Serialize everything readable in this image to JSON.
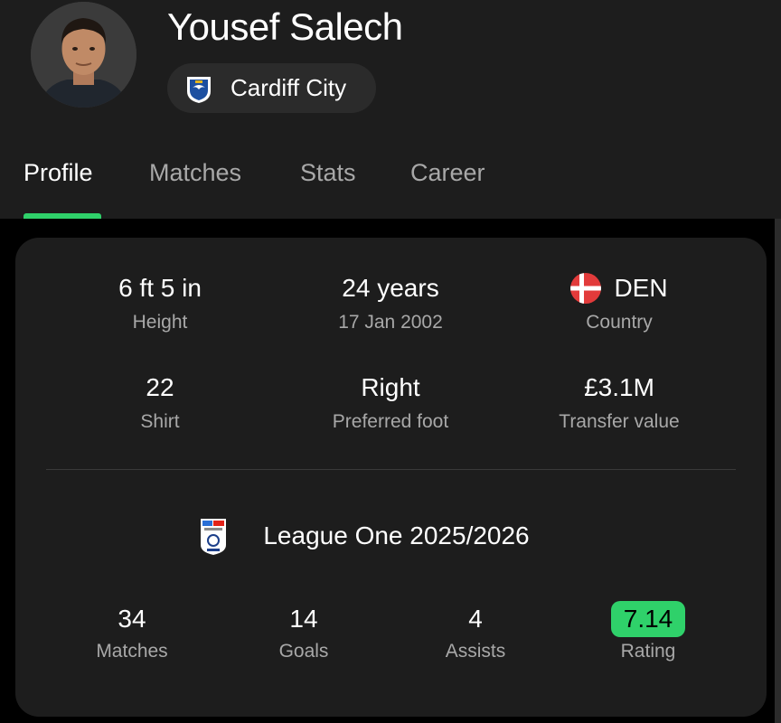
{
  "player": {
    "name": "Yousef Salech",
    "team": "Cardiff City"
  },
  "tabs": [
    "Profile",
    "Matches",
    "Stats",
    "Career"
  ],
  "active_tab": "Profile",
  "info": {
    "height": {
      "value": "6 ft 5 in",
      "label": "Height"
    },
    "age": {
      "value": "24 years",
      "label": "17 Jan 2002"
    },
    "country": {
      "value": "DEN",
      "label": "Country"
    },
    "shirt": {
      "value": "22",
      "label": "Shirt"
    },
    "foot": {
      "value": "Right",
      "label": "Preferred foot"
    },
    "transfer": {
      "value": "£3.1M",
      "label": "Transfer value"
    }
  },
  "league": {
    "name": "League One 2025/2026"
  },
  "season_stats": {
    "matches": {
      "value": "34",
      "label": "Matches"
    },
    "goals": {
      "value": "14",
      "label": "Goals"
    },
    "assists": {
      "value": "4",
      "label": "Assists"
    },
    "rating": {
      "value": "7.14",
      "label": "Rating"
    }
  },
  "colors": {
    "accent": "#2fd16a",
    "background": "#000000",
    "surface": "#1d1d1d"
  }
}
